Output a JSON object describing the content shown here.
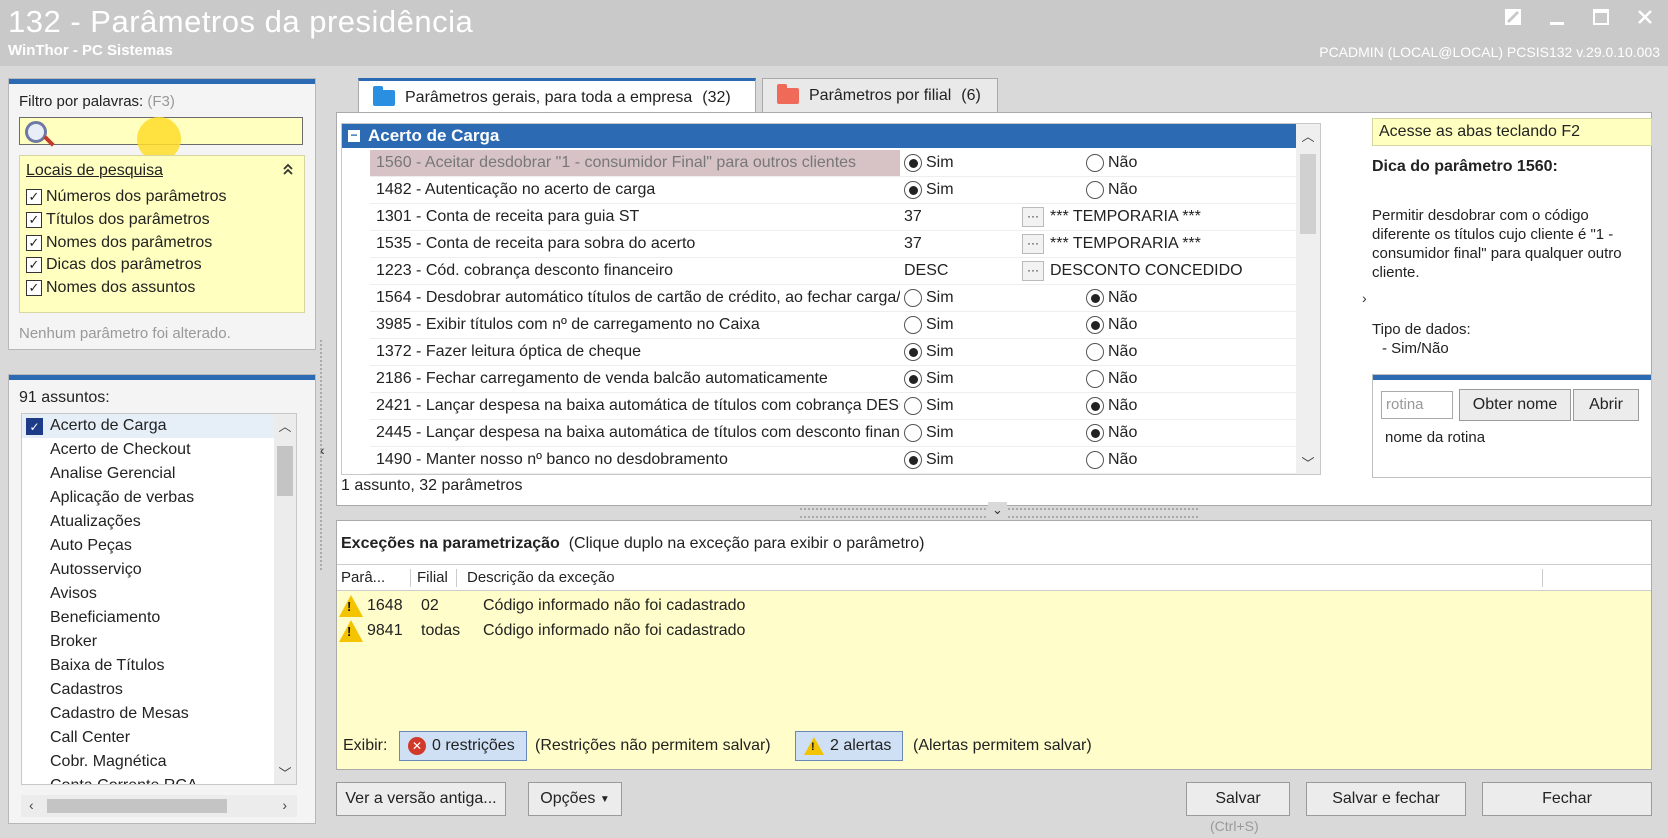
{
  "window": {
    "title": "132 - Parâmetros da presidência",
    "subtitle": "WinThor - PC Sistemas",
    "userinfo": "PCADMIN (LOCAL@LOCAL)   PCSIS132  v.29.0.10.003"
  },
  "filter": {
    "label": "Filtro por palavras:",
    "hint": "(F3)",
    "value": "",
    "locais_title": "Locais de pesquisa",
    "options": [
      {
        "label": "Números dos parâmetros",
        "checked": true
      },
      {
        "label": "Títulos dos parâmetros",
        "checked": true
      },
      {
        "label": "Nomes dos parâmetros",
        "checked": true
      },
      {
        "label": "Dicas dos parâmetros",
        "checked": true
      },
      {
        "label": "Nomes dos assuntos",
        "checked": true
      }
    ],
    "status": "Nenhum parâmetro foi alterado."
  },
  "assuntos": {
    "count_label": "91 assuntos:",
    "items": [
      "Acerto de Carga",
      "Acerto de Checkout",
      "Analise Gerencial",
      "Aplicação de verbas",
      "Atualizações",
      "Auto Peças",
      "Autosserviço",
      "Avisos",
      "Beneficiamento",
      "Broker",
      "Baixa de Títulos",
      "Cadastros",
      "Cadastro de Mesas",
      "Call Center",
      "Cobr. Magnética",
      "Conta Corrente RCA"
    ]
  },
  "tabs": [
    {
      "label": "Parâmetros gerais, para toda a empresa",
      "count": "(32)",
      "color": "#2a8fe0"
    },
    {
      "label": "Parâmetros por filial",
      "count": "(6)",
      "color": "#f06a5a"
    }
  ],
  "grid": {
    "group": "Acerto de Carga",
    "rows": [
      {
        "name": "1560 - Aceitar desdobrar \"1 - consumidor Final\" para outros clientes",
        "type": "radio",
        "value": "Sim"
      },
      {
        "name": "1482 - Autenticação no acerto de carga",
        "type": "radio",
        "value": "Sim"
      },
      {
        "name": "1301 - Conta de receita para guia ST",
        "type": "code",
        "code": "37",
        "desc": "*** TEMPORARIA ***"
      },
      {
        "name": "1535 - Conta de receita para sobra do acerto",
        "type": "code",
        "code": "37",
        "desc": "*** TEMPORARIA ***"
      },
      {
        "name": "1223 - Cód. cobrança desconto financeiro",
        "type": "code",
        "code": "DESC",
        "desc": "DESCONTO CONCEDIDO"
      },
      {
        "name": "1564 - Desdobrar automático títulos de cartão de crédito, ao fechar carga/ca",
        "type": "radio",
        "value": "Não"
      },
      {
        "name": "3985 - Exibir títulos com nº de carregamento no Caixa",
        "type": "radio",
        "value": "Não"
      },
      {
        "name": "1372 - Fazer leitura óptica de cheque",
        "type": "radio",
        "value": "Sim"
      },
      {
        "name": "2186 - Fechar carregamento de venda balcão automaticamente",
        "type": "radio",
        "value": "Sim"
      },
      {
        "name": "2421 - Lançar despesa na baixa automática de títulos com cobrança DESC.",
        "type": "radio",
        "value": "Não"
      },
      {
        "name": "2445 - Lançar despesa na baixa automática de títulos com desconto financeir",
        "type": "radio",
        "value": "Não"
      },
      {
        "name": "1490 - Manter nosso nº banco no desdobramento",
        "type": "radio",
        "value": "Sim"
      }
    ],
    "yes_label": "Sim",
    "no_label": "Não",
    "footer": "1 assunto, 32 parâmetros"
  },
  "tip": {
    "hint": "Acesse as abas teclando F2",
    "title": "Dica do parâmetro 1560:",
    "text": "Permitir desdobrar com o código diferente os títulos cujo cliente é \"1 - consumidor final\" para qualquer outro cliente.",
    "type_label": "Tipo de dados:",
    "type_value": "- Sim/Não"
  },
  "rotina": {
    "placeholder": "rotina",
    "obter_label": "Obter nome",
    "abrir_label": "Abrir",
    "name_label": "nome da rotina"
  },
  "excecoes": {
    "title": "Exceções na parametrização",
    "subtitle": "(Clique duplo na exceção para exibir o parâmetro)",
    "columns": [
      "Parâ...",
      "Filial",
      "Descrição da exceção"
    ],
    "rows": [
      {
        "param": "1648",
        "filial": "02",
        "desc": "Código informado não foi cadastrado"
      },
      {
        "param": "9841",
        "filial": "todas",
        "desc": "Código informado não foi cadastrado"
      }
    ],
    "exibir_label": "Exibir:",
    "restricoes_label": "0 restrições",
    "restricoes_note": "(Restrições não permitem salvar)",
    "alertas_label": "2 alertas",
    "alertas_note": "(Alertas permitem salvar)"
  },
  "footer": {
    "old_version": "Ver a versão antiga...",
    "options": "Opções",
    "save": "Salvar",
    "save_shortcut": "(Ctrl+S)",
    "save_close": "Salvar e fechar",
    "close": "Fechar"
  }
}
